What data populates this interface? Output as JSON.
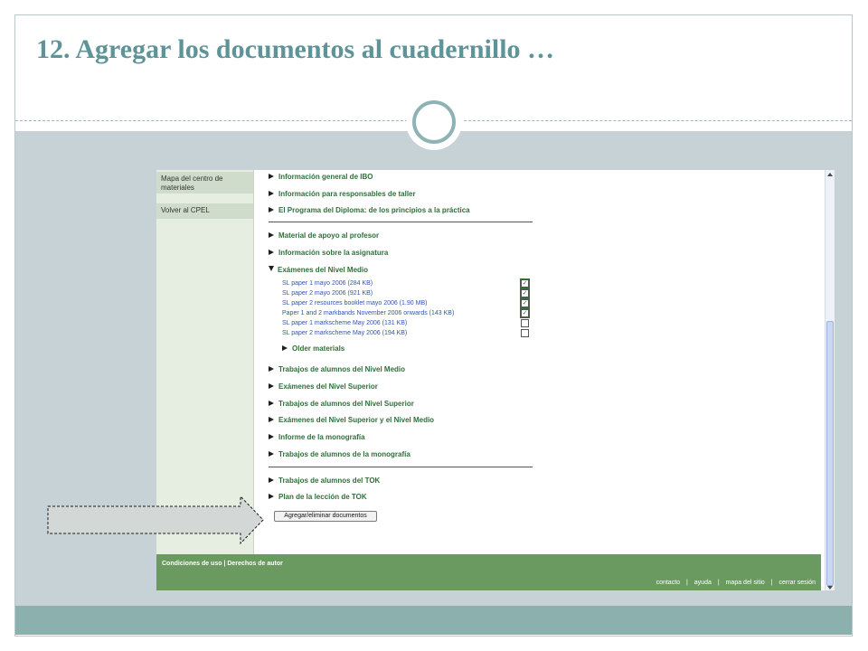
{
  "slide": {
    "title": "12. Agregar los documentos al cuadernillo …"
  },
  "left_nav": {
    "items": [
      "Mapa del centro de materiales",
      "Volver al CPEL"
    ]
  },
  "sections": {
    "info_ibo": "Información general de IBO",
    "info_responsables": "Información para responsables de taller",
    "programa_diploma": "El Programa del Diploma: de los principios a la práctica",
    "material_apoyo": "Material de apoyo al profesor",
    "info_asignatura": "Información sobre la asignatura",
    "examenes_nm": "Exámenes del Nivel Medio",
    "older_materials": "Older materials",
    "trabajos_nm": "Trabajos de alumnos del Nivel Medio",
    "examenes_ns": "Exámenes del Nivel Superior",
    "trabajos_ns": "Trabajos de alumnos del Nivel Superior",
    "examenes_ns_nm": "Exámenes del Nivel Superior y el Nivel Medio",
    "informe_monografia": "Informe de la monografía",
    "trabajos_monografia": "Trabajos de alumnos de la monografía",
    "trabajos_tok": "Trabajos de alumnos del TOK",
    "plan_tok": "Plan de la lección de TOK"
  },
  "documents": [
    {
      "label": "SL paper 1 mayo 2006 (284 KB)",
      "checked": true
    },
    {
      "label": "SL paper 2 mayo 2006 (921 KB)",
      "checked": true
    },
    {
      "label": "SL paper 2 resources booklet mayo 2006 (1.90 MB)",
      "checked": true
    },
    {
      "label": "Paper 1 and 2 markbands November 2006 onwards (143 KB)",
      "checked": true
    },
    {
      "label": "SL paper 1 markscheme May 2006 (131 KB)",
      "checked": false
    },
    {
      "label": "SL paper 2 markscheme May 2006 (194 KB)",
      "checked": false
    }
  ],
  "check_mark": "✓",
  "button": {
    "label": "Agregar/eliminar documentos"
  },
  "footer": {
    "left": "Condiciones de uso | Derechos de autor",
    "links": [
      "contacto",
      "ayuda",
      "mapa del sitio",
      "cerrar sesión"
    ],
    "separator": "|"
  },
  "colors": {
    "title": "#5e9497",
    "band": "#c7d2d6",
    "bottom_band": "#8cb0ad",
    "section_green": "#2f6f3a",
    "doc_link_blue": "#3055b0",
    "footer_green": "#6a9a60",
    "arrow_fill": "#d3d8d6"
  },
  "icons": {
    "expand": "triangle-right-icon",
    "expanded": "triangle-down-icon",
    "pointer_arrow": "block-arrow-right-icon"
  }
}
